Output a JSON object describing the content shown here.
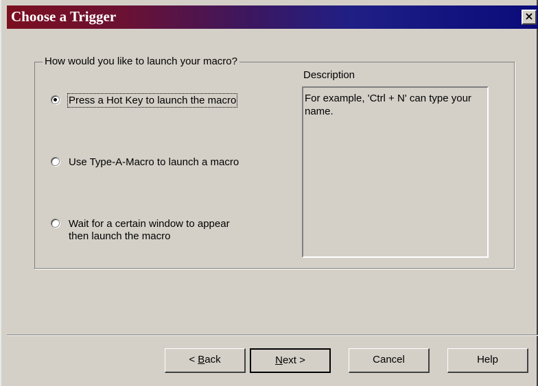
{
  "window": {
    "title": "Choose a Trigger",
    "close_glyph": "×"
  },
  "group": {
    "legend": "How would you like to launch your macro?"
  },
  "options": [
    {
      "label": "Press a Hot Key to launch the macro",
      "selected": true
    },
    {
      "label": "Use Type-A-Macro to launch a macro",
      "selected": false
    },
    {
      "label": "Wait for a certain window to appear\nthen launch the macro",
      "selected": false
    }
  ],
  "description": {
    "label": "Description",
    "text": "For example, 'Ctrl + N' can type your name."
  },
  "buttons": {
    "back": {
      "prefix": "< ",
      "accel": "B",
      "rest": "ack"
    },
    "next": {
      "accel": "N",
      "rest": "ext >"
    },
    "cancel": "Cancel",
    "help": "Help"
  }
}
